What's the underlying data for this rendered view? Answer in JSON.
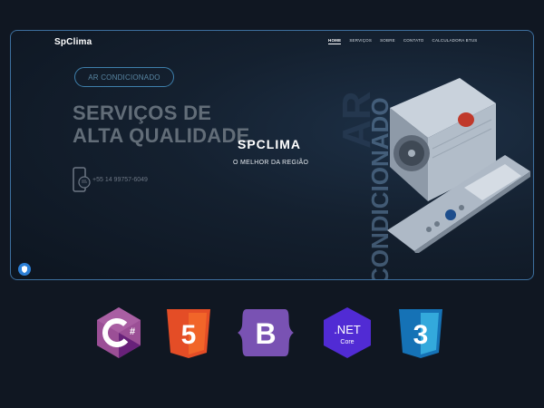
{
  "site": {
    "logo": "SpClima",
    "nav": [
      "HOME",
      "SERVIÇOS",
      "SOBRE",
      "CONTATO",
      "CALCULADORA BTUS"
    ],
    "pill": "AR CONDICIONADO",
    "headline": [
      "SERVIÇOS DE",
      "ALTA QUALIDADE"
    ],
    "phone": "+55 14 99757-6049",
    "center_title": "SPCLIMA",
    "center_subtitle": "O MELHOR DA REGIÃO",
    "vertical_text_1": "AR",
    "vertical_text_2": "CONDICIONADO"
  },
  "tech_stack": {
    "dotnet_top": ".NET",
    "dotnet_bottom": "Core",
    "bootstrap_letter": "B",
    "html_number": "5",
    "css_number": "3",
    "csharp_letter": "C#"
  },
  "colors": {
    "background": "#101722",
    "frame_border": "#3d6f9e",
    "csharp": "#9b4f96",
    "html5": "#e44d26",
    "bootstrap": "#7952b3",
    "dotnet": "#512bd4",
    "css3": "#1572b6"
  }
}
